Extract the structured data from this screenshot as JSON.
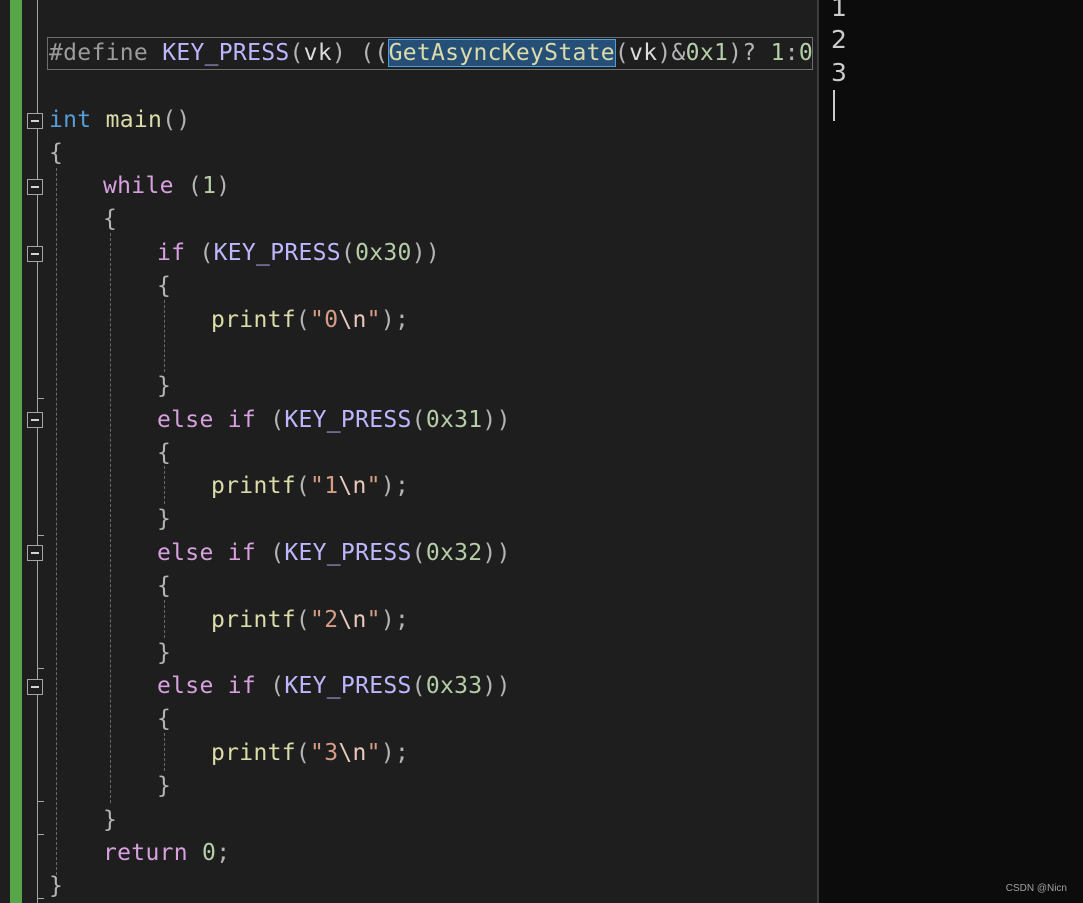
{
  "editor": {
    "define": {
      "directive": "#define",
      "name": "KEY_PRESS",
      "param": "vk",
      "selected": "GetAsyncKeyState",
      "mask": "0x1",
      "true_val": "1",
      "false_val": "0"
    },
    "main": {
      "type": "int",
      "name": "main"
    },
    "while": {
      "keyword": "while",
      "cond": "1"
    },
    "branches": [
      {
        "keyword": "if",
        "macro": "KEY_PRESS",
        "code": "0x30",
        "call": "printf",
        "str": "0",
        "esc": "\\n"
      },
      {
        "keyword": "else if",
        "macro": "KEY_PRESS",
        "code": "0x31",
        "call": "printf",
        "str": "1",
        "esc": "\\n"
      },
      {
        "keyword": "else if",
        "macro": "KEY_PRESS",
        "code": "0x32",
        "call": "printf",
        "str": "2",
        "esc": "\\n"
      },
      {
        "keyword": "else if",
        "macro": "KEY_PRESS",
        "code": "0x33",
        "call": "printf",
        "str": "3",
        "esc": "\\n"
      }
    ],
    "ret": {
      "keyword": "return",
      "value": "0"
    },
    "colors": {
      "change_bar": "#57a64a",
      "selection": "#264f78",
      "background": "#1e1e1e"
    }
  },
  "console": {
    "lines": [
      "1",
      "2",
      "3"
    ]
  },
  "watermark": "CSDN @Nicn"
}
